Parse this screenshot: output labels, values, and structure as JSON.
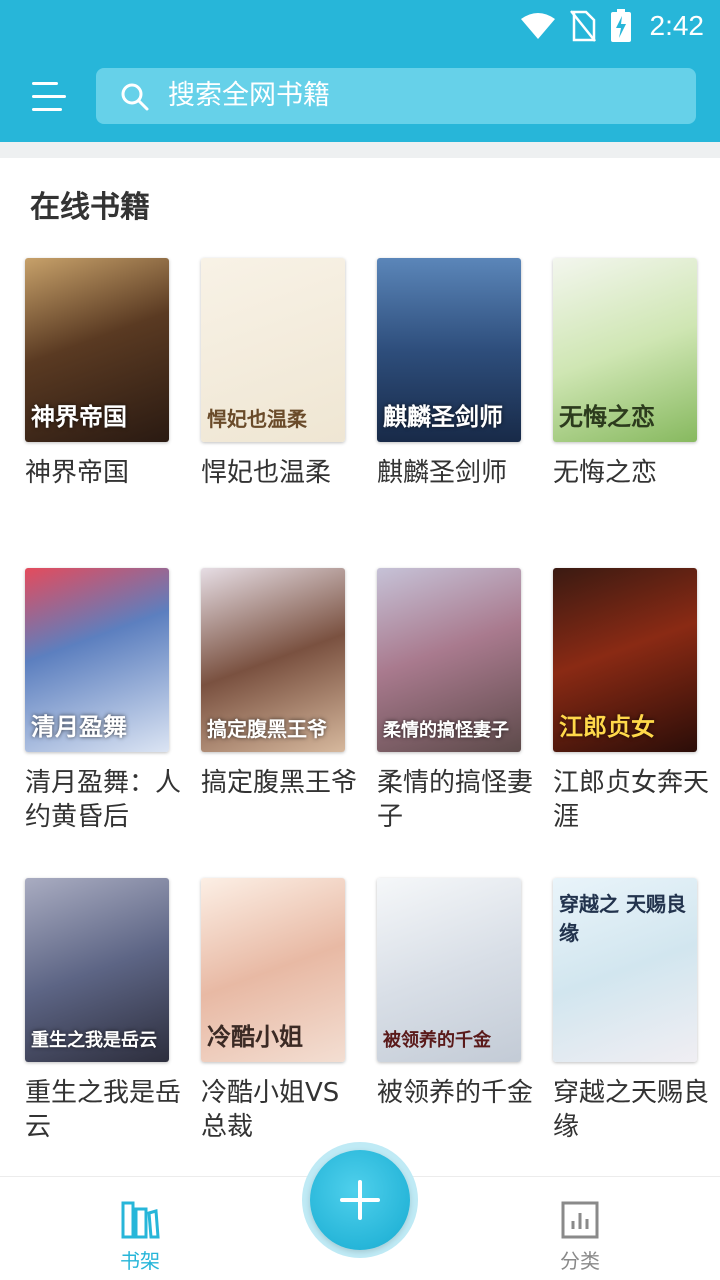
{
  "status_bar": {
    "time": "2:42",
    "icons": [
      "wifi-icon",
      "no-sim-icon",
      "battery-charging-icon"
    ]
  },
  "app_bar": {
    "menu_icon": "menu-icon",
    "search_placeholder": "搜索全网书籍"
  },
  "section": {
    "title": "在线书籍"
  },
  "books": [
    {
      "title": "神界帝国",
      "cover_text": "神界帝国"
    },
    {
      "title": "悍妃也温柔",
      "cover_text": "悍妃也温柔"
    },
    {
      "title": "麒麟圣剑师",
      "cover_text": "麒麟圣剑师"
    },
    {
      "title": "无悔之恋",
      "cover_text": "无悔之恋"
    },
    {
      "title": "清月盈舞：人约黄昏后",
      "cover_text": "清月盈舞"
    },
    {
      "title": "搞定腹黑王爷",
      "cover_text": "搞定腹黑王爷"
    },
    {
      "title": "柔情的搞怪妻子",
      "cover_text": "柔情的搞怪妻子"
    },
    {
      "title": "江郎贞女奔天涯",
      "cover_text": "江郎贞女"
    },
    {
      "title": "重生之我是岳云",
      "cover_text": "重生之我是岳云"
    },
    {
      "title": "冷酷小姐VS总裁",
      "cover_text": "冷酷小姐"
    },
    {
      "title": "被领养的千金",
      "cover_text": "被领养的千金"
    },
    {
      "title": "穿越之天赐良缘",
      "cover_text": "穿越之 天赐良缘"
    }
  ],
  "bottom_nav": {
    "bookshelf_label": "书架",
    "category_label": "分类",
    "fab_icon": "plus-icon"
  },
  "colors": {
    "primary": "#27b6d9",
    "search_bg": "#66d1e9",
    "inactive": "#8a8a8a"
  }
}
